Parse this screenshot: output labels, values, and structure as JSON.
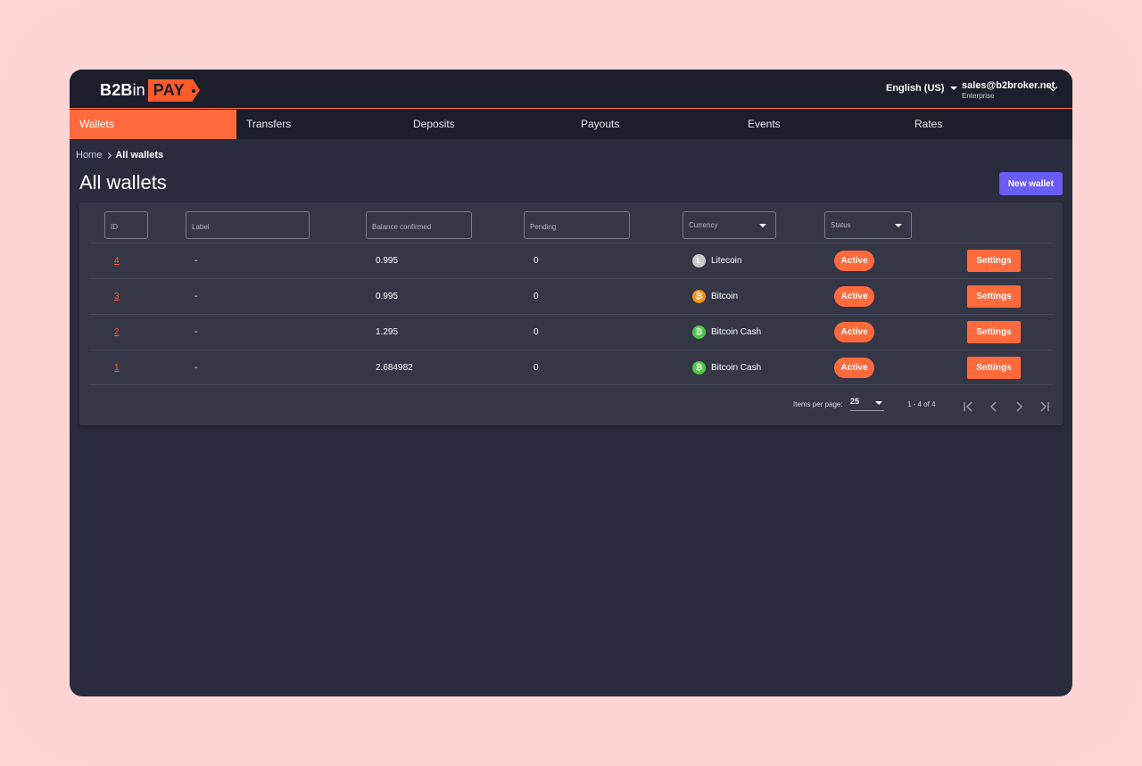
{
  "brand": {
    "part1": "B2B",
    "part2": "in",
    "part3": "PAY"
  },
  "header": {
    "language": "English (US)",
    "user_email": "sales@b2broker.net",
    "user_plan": "Enterprise"
  },
  "nav": {
    "tabs": [
      {
        "label": "Wallets",
        "active": true
      },
      {
        "label": "Transfers",
        "active": false
      },
      {
        "label": "Deposits",
        "active": false
      },
      {
        "label": "Payouts",
        "active": false
      },
      {
        "label": "Events",
        "active": false
      },
      {
        "label": "Rates",
        "active": false
      }
    ]
  },
  "breadcrumb": {
    "home": "Home",
    "current": "All wallets"
  },
  "page": {
    "title": "All wallets",
    "new_wallet_label": "New wallet"
  },
  "filters": {
    "id": "ID",
    "label": "Label",
    "balance": "Balance confirmed",
    "pending": "Pending",
    "currency": "Currency",
    "status": "Status"
  },
  "wallets": [
    {
      "id": "4",
      "label": "-",
      "balance": "0.995",
      "pending": "0",
      "currency": "Litecoin",
      "currency_icon": "litecoin-icon",
      "currency_color": "#c8c8c8",
      "status": "Active",
      "action": "Settings"
    },
    {
      "id": "3",
      "label": "-",
      "balance": "0.995",
      "pending": "0",
      "currency": "Bitcoin",
      "currency_icon": "bitcoin-icon",
      "currency_color": "#f7931a",
      "status": "Active",
      "action": "Settings"
    },
    {
      "id": "2",
      "label": "-",
      "balance": "1.295",
      "pending": "0",
      "currency": "Bitcoin Cash",
      "currency_icon": "bitcoin-cash-icon",
      "currency_color": "#4cc947",
      "status": "Active",
      "action": "Settings"
    },
    {
      "id": "1",
      "label": "-",
      "balance": "2.684982",
      "pending": "0",
      "currency": "Bitcoin Cash",
      "currency_icon": "bitcoin-cash-icon",
      "currency_color": "#4cc947",
      "status": "Active",
      "action": "Settings"
    }
  ],
  "pagination": {
    "items_per_page_label": "Items per page:",
    "items_per_page": "25",
    "range": "1 - 4 of 4"
  },
  "colors": {
    "accent": "#ff6a3d",
    "primary_button": "#6b5cf5",
    "background": "#2a2b3c",
    "card": "#353646"
  }
}
